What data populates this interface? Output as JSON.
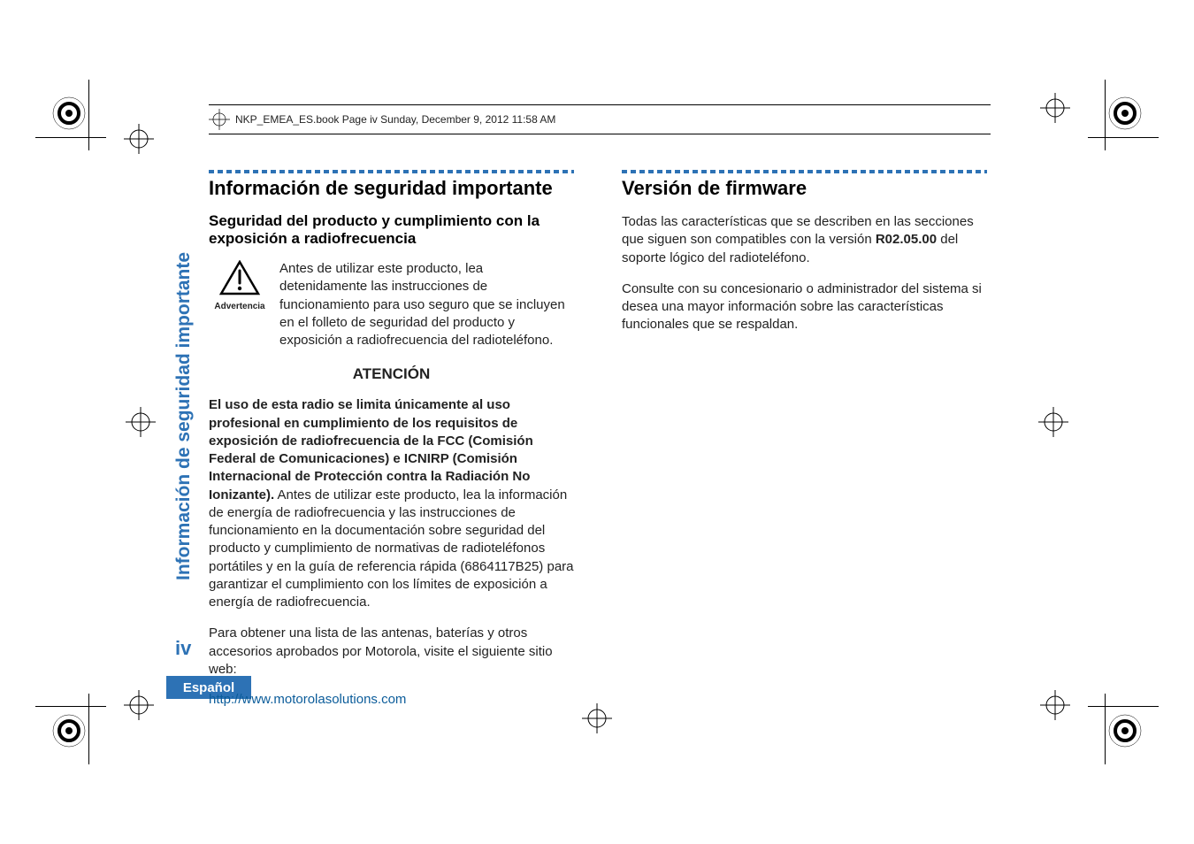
{
  "header": {
    "text": "NKP_EMEA_ES.book  Page iv  Sunday, December 9, 2012  11:58 AM"
  },
  "side": {
    "tab": "Información de seguridad importante",
    "pageNumber": "iv",
    "language": "Español"
  },
  "left": {
    "title": "Información de seguridad importante",
    "subhead": "Seguridad del producto y cumplimiento con la exposición a radiofrecuencia",
    "warnLabel": "Advertencia",
    "warnText": "Antes de utilizar este producto, lea detenidamente las instrucciones de funcionamiento para uso seguro que se incluyen en el folleto de seguridad del producto y exposición a radiofrecuencia del radioteléfono.",
    "attention": "ATENCIÓN",
    "boldPara": "El uso de esta radio se limita únicamente al uso profesional en cumplimiento de los requisitos de exposición de radiofrecuencia de la FCC (Comisión Federal de Comunicaciones) e ICNIRP (Comisión Internacional de Protección contra la Radiación No Ionizante).",
    "restPara": " Antes de utilizar este producto, lea la información de energía de radiofrecuencia y las instrucciones de funcionamiento en la documentación sobre seguridad del producto y cumplimiento de normativas de radioteléfonos portátiles y en la guía de referencia rápida (6864117B25) para garantizar el cumplimiento con los límites de exposición a energía de radiofrecuencia.",
    "accessoriesPara": "Para obtener una lista de las antenas, baterías y otros accesorios aprobados por Motorola, visite el siguiente sitio web:",
    "link": "http://www.motorolasolutions.com"
  },
  "right": {
    "title": "Versión de firmware",
    "para1a": "Todas las características que se describen en las secciones que siguen son compatibles con la versión ",
    "para1b": "R02.05.00",
    "para1c": " del soporte lógico del radioteléfono.",
    "para2": "Consulte con su concesionario o administrador del sistema si desea una mayor información sobre las características funcionales que se respaldan."
  }
}
